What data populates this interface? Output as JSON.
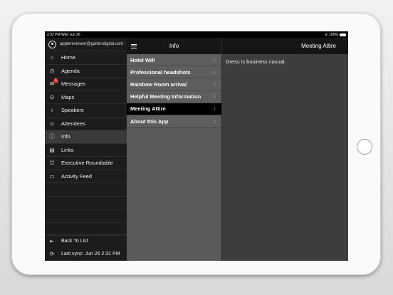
{
  "status_bar": {
    "time": "2:32 PM",
    "date": "Wed Jun 26",
    "battery": "100%"
  },
  "sidebar": {
    "user_email": "applereviewer@gatherdigital.com",
    "items": [
      {
        "label": "Home",
        "icon": "home-icon"
      },
      {
        "label": "Agenda",
        "icon": "clock-icon"
      },
      {
        "label": "Messages",
        "icon": "envelope-icon",
        "badge": "1"
      },
      {
        "label": "Maps",
        "icon": "map-pin-icon"
      },
      {
        "label": "Speakers",
        "icon": "microphone-icon"
      },
      {
        "label": "Attendees",
        "icon": "people-icon"
      },
      {
        "label": "Info",
        "icon": "info-icon",
        "active": true
      },
      {
        "label": "Links",
        "icon": "links-icon"
      },
      {
        "label": "Executive Roundtable",
        "icon": "roundtable-icon"
      },
      {
        "label": "Activity Feed",
        "icon": "chat-bubble-icon"
      }
    ],
    "back_label": "Back To List",
    "sync_label": "Last sync:  Jun 26 2:31 PM"
  },
  "middle": {
    "title": "Info",
    "rows": [
      "Hotel Wifi",
      "Professional headshots",
      "Rainbow Room arrival",
      "Helpful Meeting Information",
      "Meeting Attire",
      "About this App"
    ],
    "chevron": "〉"
  },
  "detail": {
    "title": "Meeting Attire",
    "body": "Dress is business casual."
  }
}
